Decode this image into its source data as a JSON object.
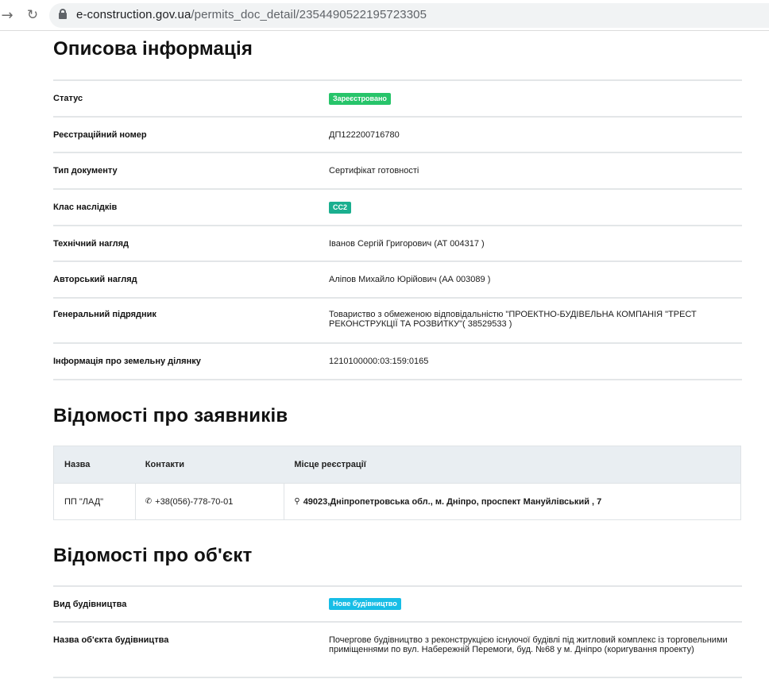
{
  "browser": {
    "url_host": "e-construction.gov.ua",
    "url_path": "/permits_doc_detail/2354490522195723305"
  },
  "descriptive": {
    "title": "Описова інформація",
    "rows": [
      {
        "label": "Статус",
        "value": "Зареєстровано"
      },
      {
        "label": "Реєстраційний номер",
        "value": "ДП122200716780"
      },
      {
        "label": "Тип документу",
        "value": "Сертифікат готовності"
      },
      {
        "label": "Клас наслідків",
        "value": "СС2"
      },
      {
        "label": "Технічний нагляд",
        "value": "Іванов Сергій Григорович (АТ 004317 )"
      },
      {
        "label": "Авторський нагляд",
        "value": "Аліпов Михайло Юрійович (АА 003089 )"
      },
      {
        "label": "Генеральний підрядник",
        "value": "Товариство з обмеженою відповідальністю \"ПРОЕКТНО-БУДІВЕЛЬНА КОМПАНІЯ \"ТРЕСТ РЕКОНСТРУКЦІЇ ТА РОЗВИТКУ\"( 38529533 )"
      },
      {
        "label": "Інформація про земельну ділянку",
        "value": "1210100000:03:159:0165"
      }
    ]
  },
  "applicants": {
    "title": "Відомості про заявників",
    "columns": [
      "Назва",
      "Контакти",
      "Місце реєстрації"
    ],
    "rows": [
      {
        "name": "ПП \"ЛАД\"",
        "phone": "+38(056)-778-70-01",
        "address": "49023,Дніпропетровська обл., м. Дніпро, проспект Мануйлівський , 7"
      }
    ]
  },
  "object": {
    "title": "Відомості про об'єкт",
    "rows": [
      {
        "label": "Вид будівництва",
        "value": "Нове будівництво"
      },
      {
        "label": "Назва об'єкта будівництва",
        "value": "Почергове будівництво з реконструкцією існуючої будівлі під житловий комплекс із торговельними приміщеннями по вул. Набережній Перемоги, буд. №68 у м. Дніпро (коригування проекту)"
      }
    ]
  },
  "colors": {
    "status_badge": "#27c46a",
    "class_badge": "#1aaf8f",
    "construction_badge": "#17bde6",
    "table_header_bg": "#e9eef2"
  },
  "icons": {
    "forward": "arrow-right-icon",
    "reload": "reload-icon",
    "lock": "lock-icon",
    "phone": "phone-icon",
    "location": "map-marker-icon"
  }
}
